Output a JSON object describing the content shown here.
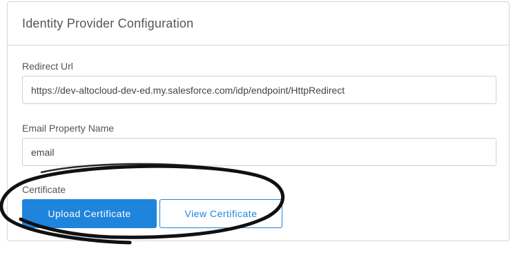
{
  "panel": {
    "title": "Identity Provider Configuration"
  },
  "fields": {
    "redirect_url": {
      "label": "Redirect Url",
      "value": "https://dev-altocloud-dev-ed.my.salesforce.com/idp/endpoint/HttpRedirect"
    },
    "email_property": {
      "label": "Email Property Name",
      "value": "email"
    },
    "certificate": {
      "label": "Certificate"
    }
  },
  "buttons": {
    "upload": "Upload Certificate",
    "view": "View Certificate"
  },
  "colors": {
    "accent": "#1e84dc",
    "border": "#d4d4d4",
    "annotation": "#111111"
  }
}
